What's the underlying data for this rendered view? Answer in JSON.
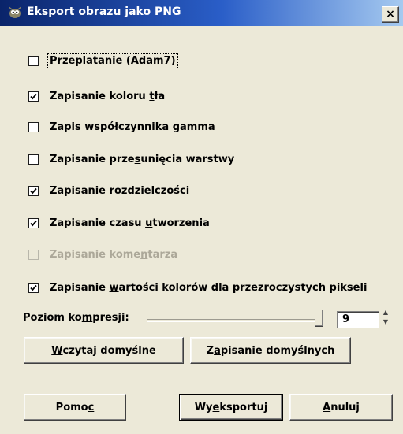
{
  "window": {
    "title": "Eksport obrazu jako PNG",
    "close_label": "×"
  },
  "options": [
    {
      "pre": "",
      "key": "P",
      "post": "rzeplatanie (Adam7)",
      "checked": false,
      "disabled": false,
      "focused": true
    },
    {
      "pre": "Zapisanie koloru ",
      "key": "t",
      "post": "ła",
      "checked": true,
      "disabled": false,
      "focused": false
    },
    {
      "pre": "Zapis współczynnika gamma",
      "key": "",
      "post": "",
      "checked": false,
      "disabled": false,
      "focused": false
    },
    {
      "pre": "Zapisanie prze",
      "key": "s",
      "post": "unięcia warstwy",
      "checked": false,
      "disabled": false,
      "focused": false
    },
    {
      "pre": "Zapisanie ",
      "key": "r",
      "post": "ozdzielczości",
      "checked": true,
      "disabled": false,
      "focused": false
    },
    {
      "pre": "Zapisanie czasu ",
      "key": "u",
      "post": "tworzenia",
      "checked": true,
      "disabled": false,
      "focused": false
    },
    {
      "pre": "Zapisanie kome",
      "key": "n",
      "post": "tarza",
      "checked": false,
      "disabled": true,
      "focused": false
    },
    {
      "pre": "Zapisanie ",
      "key": "w",
      "post": "artości kolorów dla przezroczystych pikseli",
      "checked": true,
      "disabled": false,
      "focused": false
    }
  ],
  "compression": {
    "label_pre": "Poziom ko",
    "label_key": "m",
    "label_post": "presji:",
    "value": "9",
    "level_fraction": 1.0
  },
  "buttons": {
    "load_defaults": {
      "pre": "",
      "key": "W",
      "post": "czytaj domyślne"
    },
    "save_defaults": {
      "pre": "Z",
      "key": "a",
      "post": "pisanie domyślnych"
    },
    "help": {
      "pre": "Pomo",
      "key": "c",
      "post": ""
    },
    "export": {
      "pre": "Wy",
      "key": "e",
      "post": "ksportuj"
    },
    "cancel": {
      "pre": "",
      "key": "A",
      "post": "nuluj"
    }
  },
  "colors": {
    "titlebar_start": "#0a246a",
    "titlebar_end": "#a6caf0",
    "dialog_bg": "#ece9d8",
    "disabled_text": "#aca899"
  }
}
